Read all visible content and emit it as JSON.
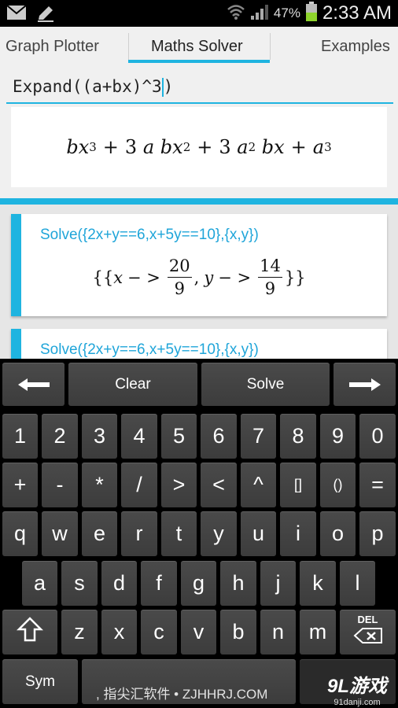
{
  "status_bar": {
    "icons_left": [
      "mail-icon",
      "pencil-icon"
    ],
    "icons_right": [
      "wifi-icon",
      "signal-icon",
      "battery-icon"
    ],
    "battery_percent": "47%",
    "time": "2:33 AM"
  },
  "tabs": [
    {
      "label": "Graph Plotter",
      "active": false
    },
    {
      "label": "Maths Solver",
      "active": true
    },
    {
      "label": "Examples",
      "active": false
    }
  ],
  "input": {
    "before_cursor": "Expand((a+bx)^3",
    "after_cursor": ")"
  },
  "current_result": {
    "t1": "bx",
    "e1": "3",
    "plus1": "+",
    "c2": "3",
    "t2a": "a",
    "t2b": "bx",
    "e2": "2",
    "plus2": "+",
    "c3": "3",
    "t3a": "a",
    "e3": "2",
    "t3b": "bx",
    "plus3": "+",
    "t4": "a",
    "e4": "3"
  },
  "history": [
    {
      "command": "Solve({2x+y==6,x+5y==10},{x,y})",
      "result": {
        "open": "{{",
        "var1": "x",
        "arrow1": "− >",
        "num1": "20",
        "den1": "9",
        "comma": ",",
        "var2": "y",
        "arrow2": "− >",
        "num2": "14",
        "den2": "9",
        "close": "}}"
      }
    },
    {
      "command": "Solve({2x+y==6,x+5y==10},{x,y})"
    }
  ],
  "keyboard": {
    "top_row": {
      "left_arrow": "⟵",
      "clear": "Clear",
      "solve": "Solve",
      "right_arrow": "⟶"
    },
    "digits": [
      "1",
      "2",
      "3",
      "4",
      "5",
      "6",
      "7",
      "8",
      "9",
      "0"
    ],
    "operators": [
      "+",
      "-",
      "*",
      "/",
      ">",
      "<",
      "^",
      "[]",
      "()",
      "="
    ],
    "row_qwerty": [
      "q",
      "w",
      "e",
      "r",
      "t",
      "y",
      "u",
      "i",
      "o",
      "p"
    ],
    "row_asdf": [
      "a",
      "s",
      "d",
      "f",
      "g",
      "h",
      "j",
      "k",
      "l"
    ],
    "row_zxcv": [
      "z",
      "x",
      "c",
      "v",
      "b",
      "n",
      "m"
    ],
    "shift_icon": "shift-icon",
    "del_label": "DEL",
    "sym_label": "Sym"
  },
  "watermark": {
    "left": ", 指尖汇软件 • ZJHHRJ.COM",
    "logo": "9L游戏",
    "site": "91danji.com"
  }
}
